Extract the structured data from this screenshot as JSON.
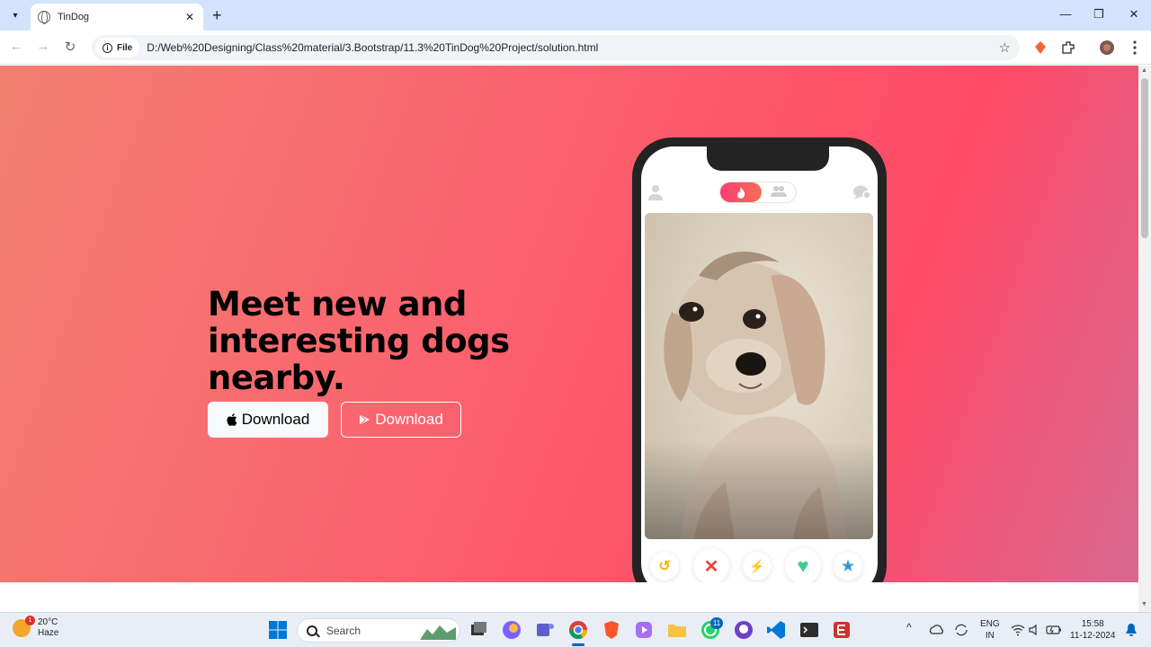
{
  "browser": {
    "tab_title": "TinDog",
    "tab_close": "✕",
    "new_tab": "+",
    "window_minimize": "—",
    "window_restore": "❐",
    "window_close": "✕",
    "back": "←",
    "forward": "→",
    "reload": "↻",
    "site_chip": "File",
    "site_info_glyph": "i",
    "url": "D:/Web%20Designing/Class%20material/3.Bootstrap/11.3%20TinDog%20Project/solution.html",
    "bookmark_star": "☆"
  },
  "page": {
    "headline": "Meet new and interesting dogs nearby.",
    "buttons": [
      {
        "label": "Download",
        "icon": "apple-icon"
      },
      {
        "label": "Download",
        "icon": "google-play-icon"
      }
    ],
    "phone": {
      "toggle_left_icon": "flame-icon",
      "toggle_right_icon": "people-icon",
      "actions": [
        {
          "name": "rewind",
          "glyph": "↺",
          "color": "#f7b500"
        },
        {
          "name": "nope",
          "glyph": "✕",
          "color": "#e84545"
        },
        {
          "name": "boost",
          "glyph": "⚡",
          "color": "#9b59e6"
        },
        {
          "name": "like",
          "glyph": "♥",
          "color": "#3ecf8e"
        },
        {
          "name": "super-like",
          "glyph": "★",
          "color": "#2d9cdb"
        }
      ]
    }
  },
  "taskbar": {
    "weather_temp": "20°C",
    "weather_desc": "Haze",
    "weather_badge": "1",
    "search_placeholder": "Search",
    "whatsapp_badge": "11",
    "lang_top": "ENG",
    "lang_bottom": "IN",
    "time": "15:58",
    "date": "11-12-2024",
    "overflow_chevron": "^"
  },
  "colors": {
    "hero_start": "#f27f70",
    "hero_end": "#ff4a66",
    "tab_strip": "#d3e3fd"
  }
}
